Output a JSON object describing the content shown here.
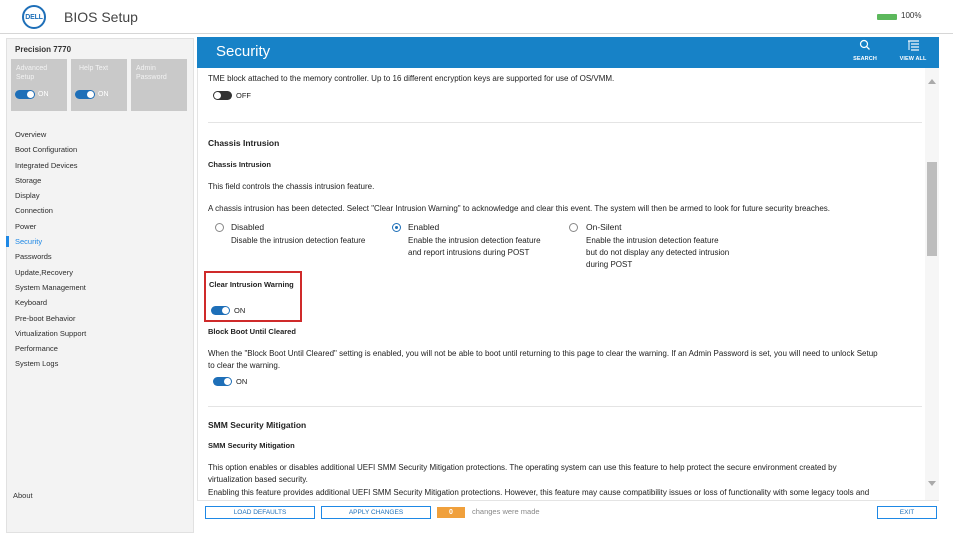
{
  "app": {
    "title": "BIOS Setup",
    "logo_text": "DELL",
    "battery": "100%"
  },
  "sidebar": {
    "model": "Precision 7770",
    "modes": [
      {
        "label": "Advanced Setup",
        "toggle": "ON"
      },
      {
        "label": "Help Text",
        "toggle": "ON"
      },
      {
        "label": "Admin Password"
      }
    ],
    "items": [
      {
        "label": "Overview"
      },
      {
        "label": "Boot Configuration"
      },
      {
        "label": "Integrated Devices"
      },
      {
        "label": "Storage"
      },
      {
        "label": "Display"
      },
      {
        "label": "Connection"
      },
      {
        "label": "Power"
      },
      {
        "label": "Security",
        "active": true
      },
      {
        "label": "Passwords"
      },
      {
        "label": "Update,Recovery"
      },
      {
        "label": "System Management"
      },
      {
        "label": "Keyboard"
      },
      {
        "label": "Pre-boot Behavior"
      },
      {
        "label": "Virtualization Support"
      },
      {
        "label": "Performance"
      },
      {
        "label": "System Logs"
      }
    ],
    "about": "About"
  },
  "header": {
    "title": "Security",
    "search_label": "SEARCH",
    "viewall_label": "VIEW ALL"
  },
  "content": {
    "tme_text": "TME block attached to the memory controller. Up to 16 different encryption keys are supported for use of OS/VMM.",
    "tme_toggle": "OFF",
    "chassis_section": "Chassis Intrusion",
    "chassis_subtitle": "Chassis Intrusion",
    "chassis_desc": "This field controls the chassis intrusion feature.",
    "chassis_warning": "A chassis intrusion has been detected. Select \"Clear Intrusion Warning\" to acknowledge and clear this event. The system will then be armed to look for future security breaches.",
    "options": [
      {
        "label": "Disabled",
        "desc": "Disable the intrusion detection feature",
        "selected": false
      },
      {
        "label": "Enabled",
        "desc1": "Enable the intrusion detection feature",
        "desc2": "and report intrusions during POST",
        "selected": true
      },
      {
        "label": "On-Silent",
        "desc1": "Enable the intrusion detection feature",
        "desc2": "but do not display any detected intrusion",
        "desc3": "during POST",
        "selected": false
      }
    ],
    "clear_title": "Clear Intrusion Warning",
    "clear_toggle": "ON",
    "block_title": "Block Boot Until Cleared",
    "block_desc1": "When the \"Block Boot Until Cleared\" setting is enabled, you will not be able to boot until returning to this page to clear the warning. If an Admin Password is set, you will need to unlock Setup",
    "block_desc2": "to clear the warning.",
    "block_toggle": "ON",
    "smm_section": "SMM Security Mitigation",
    "smm_subtitle": "SMM Security Mitigation",
    "smm_desc1": "This option enables or disables additional UEFI SMM Security Mitigation protections. The operating system can use this feature to help protect the secure environment created by",
    "smm_desc2": "virtualization based security.",
    "smm_desc3": "Enabling this feature provides additional UEFI SMM Security Mitigation protections. However, this feature may cause compatibility issues or loss of functionality with some legacy tools and"
  },
  "footer": {
    "load_defaults": "LOAD DEFAULTS",
    "apply_changes": "APPLY CHANGES",
    "changes_count": "0",
    "changes_text": "changes were made",
    "exit": "EXIT"
  },
  "colors": {
    "accent": "#1782c7",
    "highlight_box": "#cf2a2a",
    "changes_badge": "#f0a03c"
  },
  "icons": {
    "search": "search-icon",
    "viewall": "view-all-icon"
  }
}
